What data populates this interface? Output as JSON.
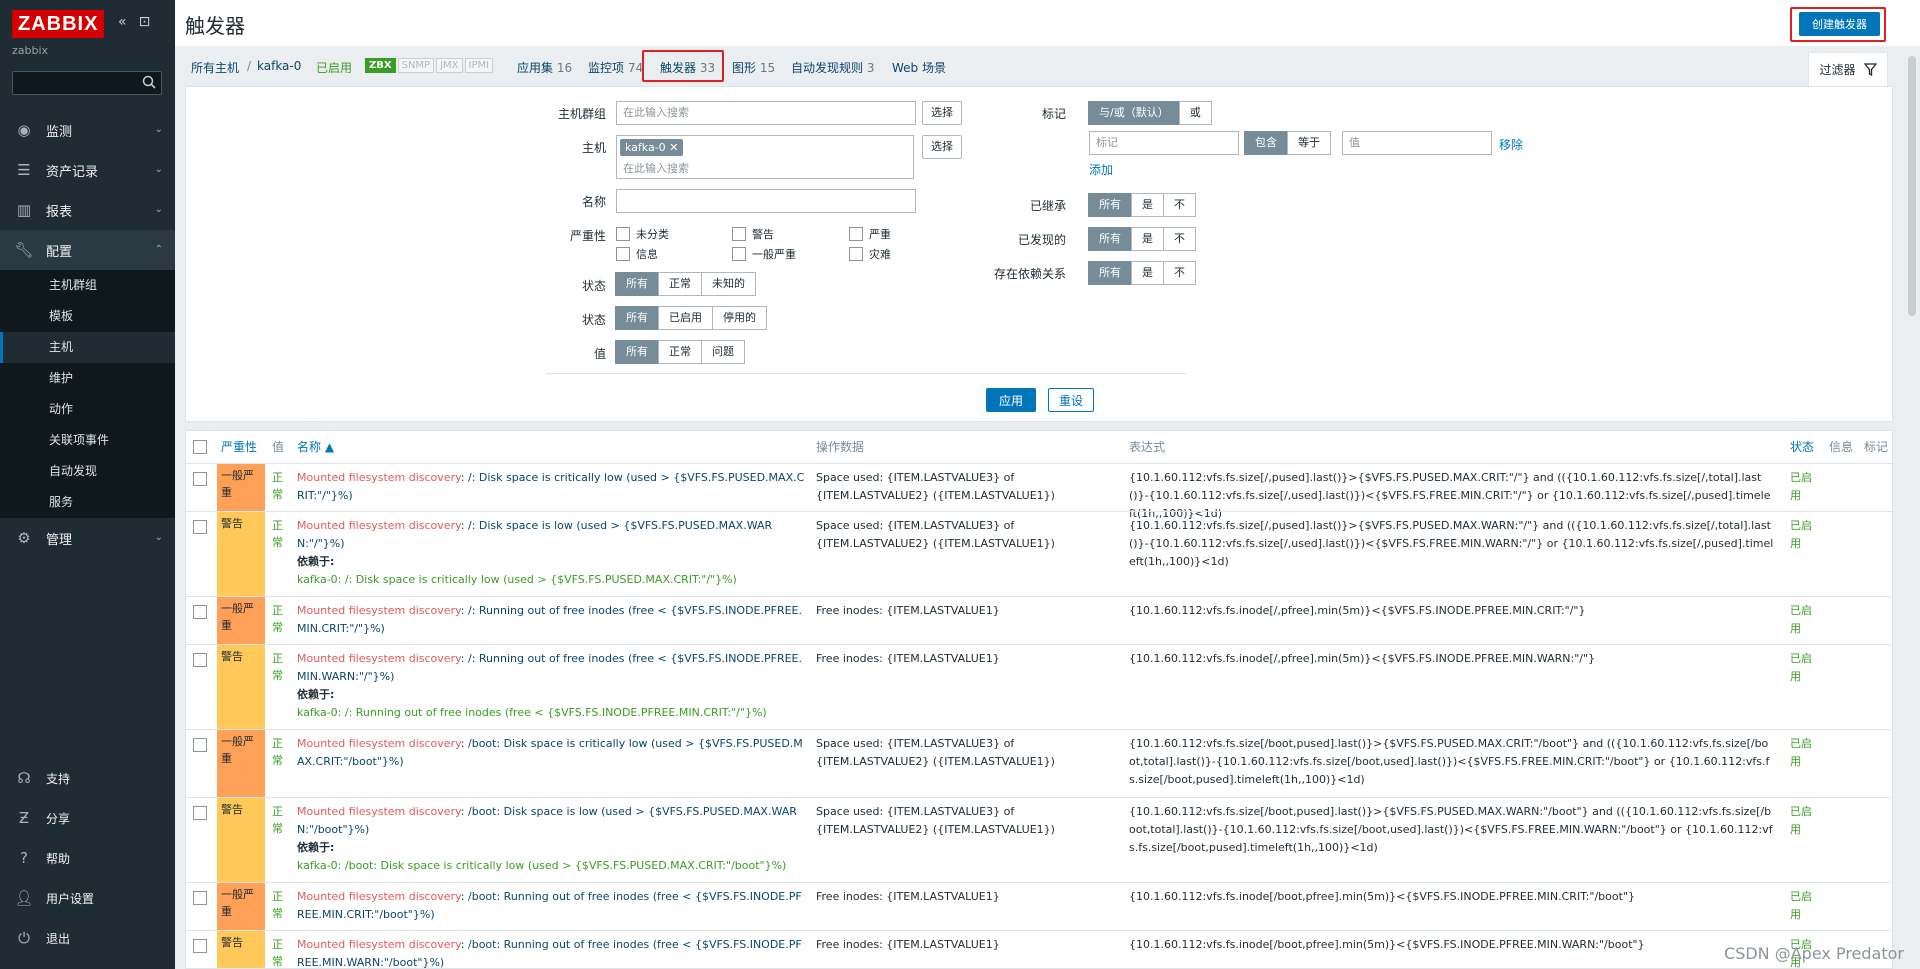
{
  "app": {
    "logo": "ZABBIX",
    "server": "zabbix"
  },
  "sidebar": {
    "menu": [
      {
        "label": "监测",
        "icon": "eye-icon"
      },
      {
        "label": "资产记录",
        "icon": "list-icon"
      },
      {
        "label": "报表",
        "icon": "report-icon"
      },
      {
        "label": "配置",
        "icon": "wrench-icon"
      }
    ],
    "config_items": [
      "主机群组",
      "模板",
      "主机",
      "维护",
      "动作",
      "关联项事件",
      "自动发现",
      "服务"
    ],
    "admin": "管理",
    "bottom": [
      {
        "label": "支持",
        "icon": "support-icon"
      },
      {
        "label": "分享",
        "icon": "share-icon"
      },
      {
        "label": "帮助",
        "icon": "help-icon"
      },
      {
        "label": "用户设置",
        "icon": "user-icon"
      },
      {
        "label": "退出",
        "icon": "power-icon"
      }
    ]
  },
  "header": {
    "title": "触发器",
    "create_button": "创建触发器"
  },
  "hostnav": {
    "all_hosts": "所有主机",
    "sep": "/",
    "host": "kafka-0",
    "enabled": "已启用",
    "avail": [
      "ZBX",
      "SNMP",
      "JMX",
      "IPMI"
    ],
    "tabs": [
      {
        "label": "应用集",
        "count": "16"
      },
      {
        "label": "监控项",
        "count": "74"
      },
      {
        "label": "触发器",
        "count": "33"
      },
      {
        "label": "图形",
        "count": "15"
      },
      {
        "label": "自动发现规则",
        "count": "3"
      },
      {
        "label": "Web 场景",
        "count": ""
      }
    ],
    "filter": "过滤器"
  },
  "filter": {
    "host_group_label": "主机群组",
    "host_group_ph": "在此输入搜索",
    "host_label": "主机",
    "host_chip": "kafka-0",
    "host_ph": "在此输入搜索",
    "select": "选择",
    "name_label": "名称",
    "severity_label": "严重性",
    "severities": [
      "未分类",
      "警告",
      "严重",
      "信息",
      "一般严重",
      "灾难"
    ],
    "state_label": "状态",
    "state_opts": [
      "所有",
      "正常",
      "未知的"
    ],
    "status_label": "状态",
    "status_opts": [
      "所有",
      "已启用",
      "停用的"
    ],
    "value_label": "值",
    "value_opts": [
      "所有",
      "正常",
      "问题"
    ],
    "tags_label": "标记",
    "tags_opts": [
      "与/或（默认）",
      "或"
    ],
    "tag_ph": "标记",
    "tag_ops": [
      "包含",
      "等于"
    ],
    "tag_value_ph": "值",
    "remove": "移除",
    "add": "添加",
    "inherited_label": "已继承",
    "discovered_label": "已发现的",
    "depends_label": "存在依赖关系",
    "tri_opts": [
      "所有",
      "是",
      "不"
    ],
    "apply": "应用",
    "reset": "重设"
  },
  "table": {
    "headers": [
      "严重性",
      "值",
      "名称 ▲",
      "操作数据",
      "表达式",
      "状态",
      "信息",
      "标记"
    ],
    "rows": [
      {
        "severity": "一般严重",
        "value": "正常",
        "disc": "Mounted filesystem discovery",
        "name": ": /: Disk space is critically low (used > {$VFS.FS.PUSED.MAX.CRIT:\"/\"}%)",
        "dep": "",
        "opdata": "Space used: {ITEM.LASTVALUE3} of {ITEM.LASTVALUE2} ({ITEM.LASTVALUE1})",
        "expr": "{10.1.60.112:vfs.fs.size[/,pused].last()}>{$VFS.FS.PUSED.MAX.CRIT:\"/\"} and (({10.1.60.112:vfs.fs.size[/,total].last()}-{10.1.60.112:vfs.fs.size[/,used].last()})<{$VFS.FS.FREE.MIN.CRIT:\"/\"} or {10.1.60.112:vfs.fs.size[/,pused].timeleft(1h,,100)}<1d)",
        "status": "已启用"
      },
      {
        "severity": "警告",
        "value": "正常",
        "disc": "Mounted filesystem discovery",
        "name": ": /: Disk space is low (used > {$VFS.FS.PUSED.MAX.WARN:\"/\"}%)",
        "dep": "kafka-0: /: Disk space is critically low (used > {$VFS.FS.PUSED.MAX.CRIT:\"/\"}%)",
        "opdata": "Space used: {ITEM.LASTVALUE3} of {ITEM.LASTVALUE2} ({ITEM.LASTVALUE1})",
        "expr": "{10.1.60.112:vfs.fs.size[/,pused].last()}>{$VFS.FS.PUSED.MAX.WARN:\"/\"} and (({10.1.60.112:vfs.fs.size[/,total].last()}-{10.1.60.112:vfs.fs.size[/,used].last()})<{$VFS.FS.FREE.MIN.WARN:\"/\"} or {10.1.60.112:vfs.fs.size[/,pused].timeleft(1h,,100)}<1d)",
        "status": "已启用"
      },
      {
        "severity": "一般严重",
        "value": "正常",
        "disc": "Mounted filesystem discovery",
        "name": ": /: Running out of free inodes (free < {$VFS.FS.INODE.PFREE.MIN.CRIT:\"/\"}%)",
        "dep": "",
        "opdata": "Free inodes: {ITEM.LASTVALUE1}",
        "expr": "{10.1.60.112:vfs.fs.inode[/,pfree].min(5m)}<{$VFS.FS.INODE.PFREE.MIN.CRIT:\"/\"}",
        "status": "已启用"
      },
      {
        "severity": "警告",
        "value": "正常",
        "disc": "Mounted filesystem discovery",
        "name": ": /: Running out of free inodes (free < {$VFS.FS.INODE.PFREE.MIN.WARN:\"/\"}%)",
        "dep": "kafka-0: /: Running out of free inodes (free < {$VFS.FS.INODE.PFREE.MIN.CRIT:\"/\"}%)",
        "opdata": "Free inodes: {ITEM.LASTVALUE1}",
        "expr": "{10.1.60.112:vfs.fs.inode[/,pfree].min(5m)}<{$VFS.FS.INODE.PFREE.MIN.WARN:\"/\"}",
        "status": "已启用"
      },
      {
        "severity": "一般严重",
        "value": "正常",
        "disc": "Mounted filesystem discovery",
        "name": ": /boot: Disk space is critically low (used > {$VFS.FS.PUSED.MAX.CRIT:\"/boot\"}%)",
        "dep": "",
        "opdata": "Space used: {ITEM.LASTVALUE3} of {ITEM.LASTVALUE2} ({ITEM.LASTVALUE1})",
        "expr": "{10.1.60.112:vfs.fs.size[/boot,pused].last()}>{$VFS.FS.PUSED.MAX.CRIT:\"/boot\"} and (({10.1.60.112:vfs.fs.size[/boot,total].last()}-{10.1.60.112:vfs.fs.size[/boot,used].last()})<{$VFS.FS.FREE.MIN.CRIT:\"/boot\"} or {10.1.60.112:vfs.fs.size[/boot,pused].timeleft(1h,,100)}<1d)",
        "status": "已启用"
      },
      {
        "severity": "警告",
        "value": "正常",
        "disc": "Mounted filesystem discovery",
        "name": ": /boot: Disk space is low (used > {$VFS.FS.PUSED.MAX.WARN:\"/boot\"}%)",
        "dep": "kafka-0: /boot: Disk space is critically low (used > {$VFS.FS.PUSED.MAX.CRIT:\"/boot\"}%)",
        "opdata": "Space used: {ITEM.LASTVALUE3} of {ITEM.LASTVALUE2} ({ITEM.LASTVALUE1})",
        "expr": "{10.1.60.112:vfs.fs.size[/boot,pused].last()}>{$VFS.FS.PUSED.MAX.WARN:\"/boot\"} and (({10.1.60.112:vfs.fs.size[/boot,total].last()}-{10.1.60.112:vfs.fs.size[/boot,used].last()})<{$VFS.FS.FREE.MIN.WARN:\"/boot\"} or {10.1.60.112:vfs.fs.size[/boot,pused].timeleft(1h,,100)}<1d)",
        "status": "已启用"
      },
      {
        "severity": "一般严重",
        "value": "正常",
        "disc": "Mounted filesystem discovery",
        "name": ": /boot: Running out of free inodes (free < {$VFS.FS.INODE.PFREE.MIN.CRIT:\"/boot\"}%)",
        "dep": "",
        "opdata": "Free inodes: {ITEM.LASTVALUE1}",
        "expr": "{10.1.60.112:vfs.fs.inode[/boot,pfree].min(5m)}<{$VFS.FS.INODE.PFREE.MIN.CRIT:\"/boot\"}",
        "status": "已启用"
      },
      {
        "severity": "警告",
        "value": "正常",
        "disc": "Mounted filesystem discovery",
        "name": ": /boot: Running out of free inodes (free < {$VFS.FS.INODE.PFREE.MIN.WARN:\"/boot\"}%)",
        "dep": "",
        "opdata": "Free inodes: {ITEM.LASTVALUE1}",
        "expr": "{10.1.60.112:vfs.fs.inode[/boot,pfree].min(5m)}<{$VFS.FS.INODE.PFREE.MIN.WARN:\"/boot\"}",
        "status": "已启用"
      }
    ],
    "depends_on": "依赖于:"
  },
  "watermark": "CSDN @Apex  Predator",
  "colors": {
    "sidebar": "#1f2c33",
    "accent": "#0275b8",
    "avg": "#ffa059",
    "warn": "#ffc859",
    "ok": "#3a9d23",
    "highlight": "#e02020"
  }
}
